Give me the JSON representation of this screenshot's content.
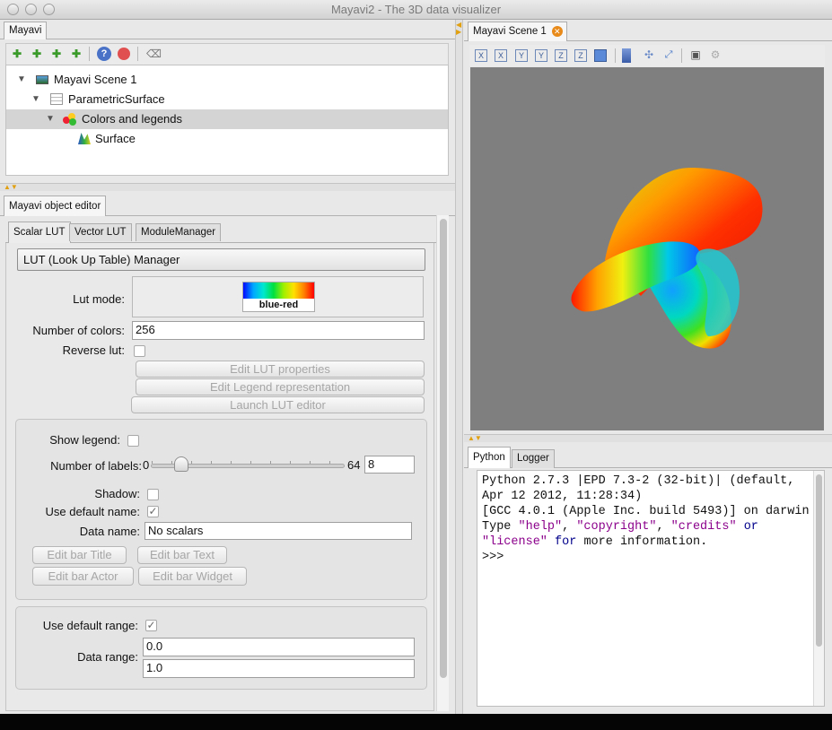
{
  "window": {
    "title": "Mayavi2 - The 3D data visualizer"
  },
  "left_top": {
    "tab": "Mayavi",
    "tree": [
      {
        "label": "Mayavi Scene 1",
        "icon": "scene-icon"
      },
      {
        "label": "ParametricSurface",
        "icon": "grid-icon"
      },
      {
        "label": "Colors and legends",
        "icon": "colors-icon"
      },
      {
        "label": "Surface",
        "icon": "surface-icon"
      }
    ]
  },
  "editor": {
    "panel_tab": "Mayavi object editor",
    "tabs": [
      "Scalar LUT",
      "Vector LUT",
      "ModuleManager"
    ],
    "manager_button": "LUT (Look Up Table) Manager",
    "lut_mode_label": "Lut mode:",
    "lut_mode_value": "blue-red",
    "num_colors_label": "Number of colors:",
    "num_colors_value": "256",
    "reverse_lut_label": "Reverse lut:",
    "edit_lut_props": "Edit LUT properties",
    "edit_legend_repr": "Edit Legend representation",
    "launch_lut_editor": "Launch LUT editor",
    "show_legend_label": "Show legend:",
    "num_labels_label": "Number of labels:",
    "slider_min": "0",
    "slider_max": "64",
    "slider_value": 8,
    "num_labels_value": "8",
    "shadow_label": "Shadow:",
    "use_default_name_label": "Use default name:",
    "data_name_label": "Data name:",
    "data_name_value": "No scalars",
    "edit_bar_title": "Edit bar Title",
    "edit_bar_text": "Edit bar Text",
    "edit_bar_actor": "Edit bar Actor",
    "edit_bar_widget": "Edit bar Widget",
    "use_default_range_label": "Use default range:",
    "data_range_label": "Data range:",
    "range_min": "0.0",
    "range_max": "1.0"
  },
  "scene": {
    "tab": "Mayavi Scene 1",
    "background": "#7f7f7f"
  },
  "console": {
    "tabs": [
      "Python",
      "Logger"
    ],
    "lines": [
      [
        {
          "t": "Python 2.7.3 |EPD 7.3-2 (32-bit)| (default,",
          "c": "#111"
        }
      ],
      [
        {
          "t": "Apr 12 2012, 11:28:34)",
          "c": "#111"
        }
      ],
      [
        {
          "t": "[GCC 4.0.1 (Apple Inc. build 5493)] on darwin",
          "c": "#111"
        }
      ],
      [
        {
          "t": "Type ",
          "c": "#111"
        },
        {
          "t": "\"help\"",
          "c": "#8b008b"
        },
        {
          "t": ", ",
          "c": "#111"
        },
        {
          "t": "\"copyright\"",
          "c": "#8b008b"
        },
        {
          "t": ", ",
          "c": "#111"
        },
        {
          "t": "\"credits\"",
          "c": "#8b008b"
        },
        {
          "t": " ",
          "c": "#111"
        },
        {
          "t": "or",
          "c": "#00008b"
        }
      ],
      [
        {
          "t": "\"license\"",
          "c": "#8b008b"
        },
        {
          "t": " ",
          "c": "#111"
        },
        {
          "t": "for",
          "c": "#00008b"
        },
        {
          "t": " more information.",
          "c": "#111"
        }
      ],
      [
        {
          "t": ">>>",
          "c": "#111"
        }
      ]
    ]
  }
}
